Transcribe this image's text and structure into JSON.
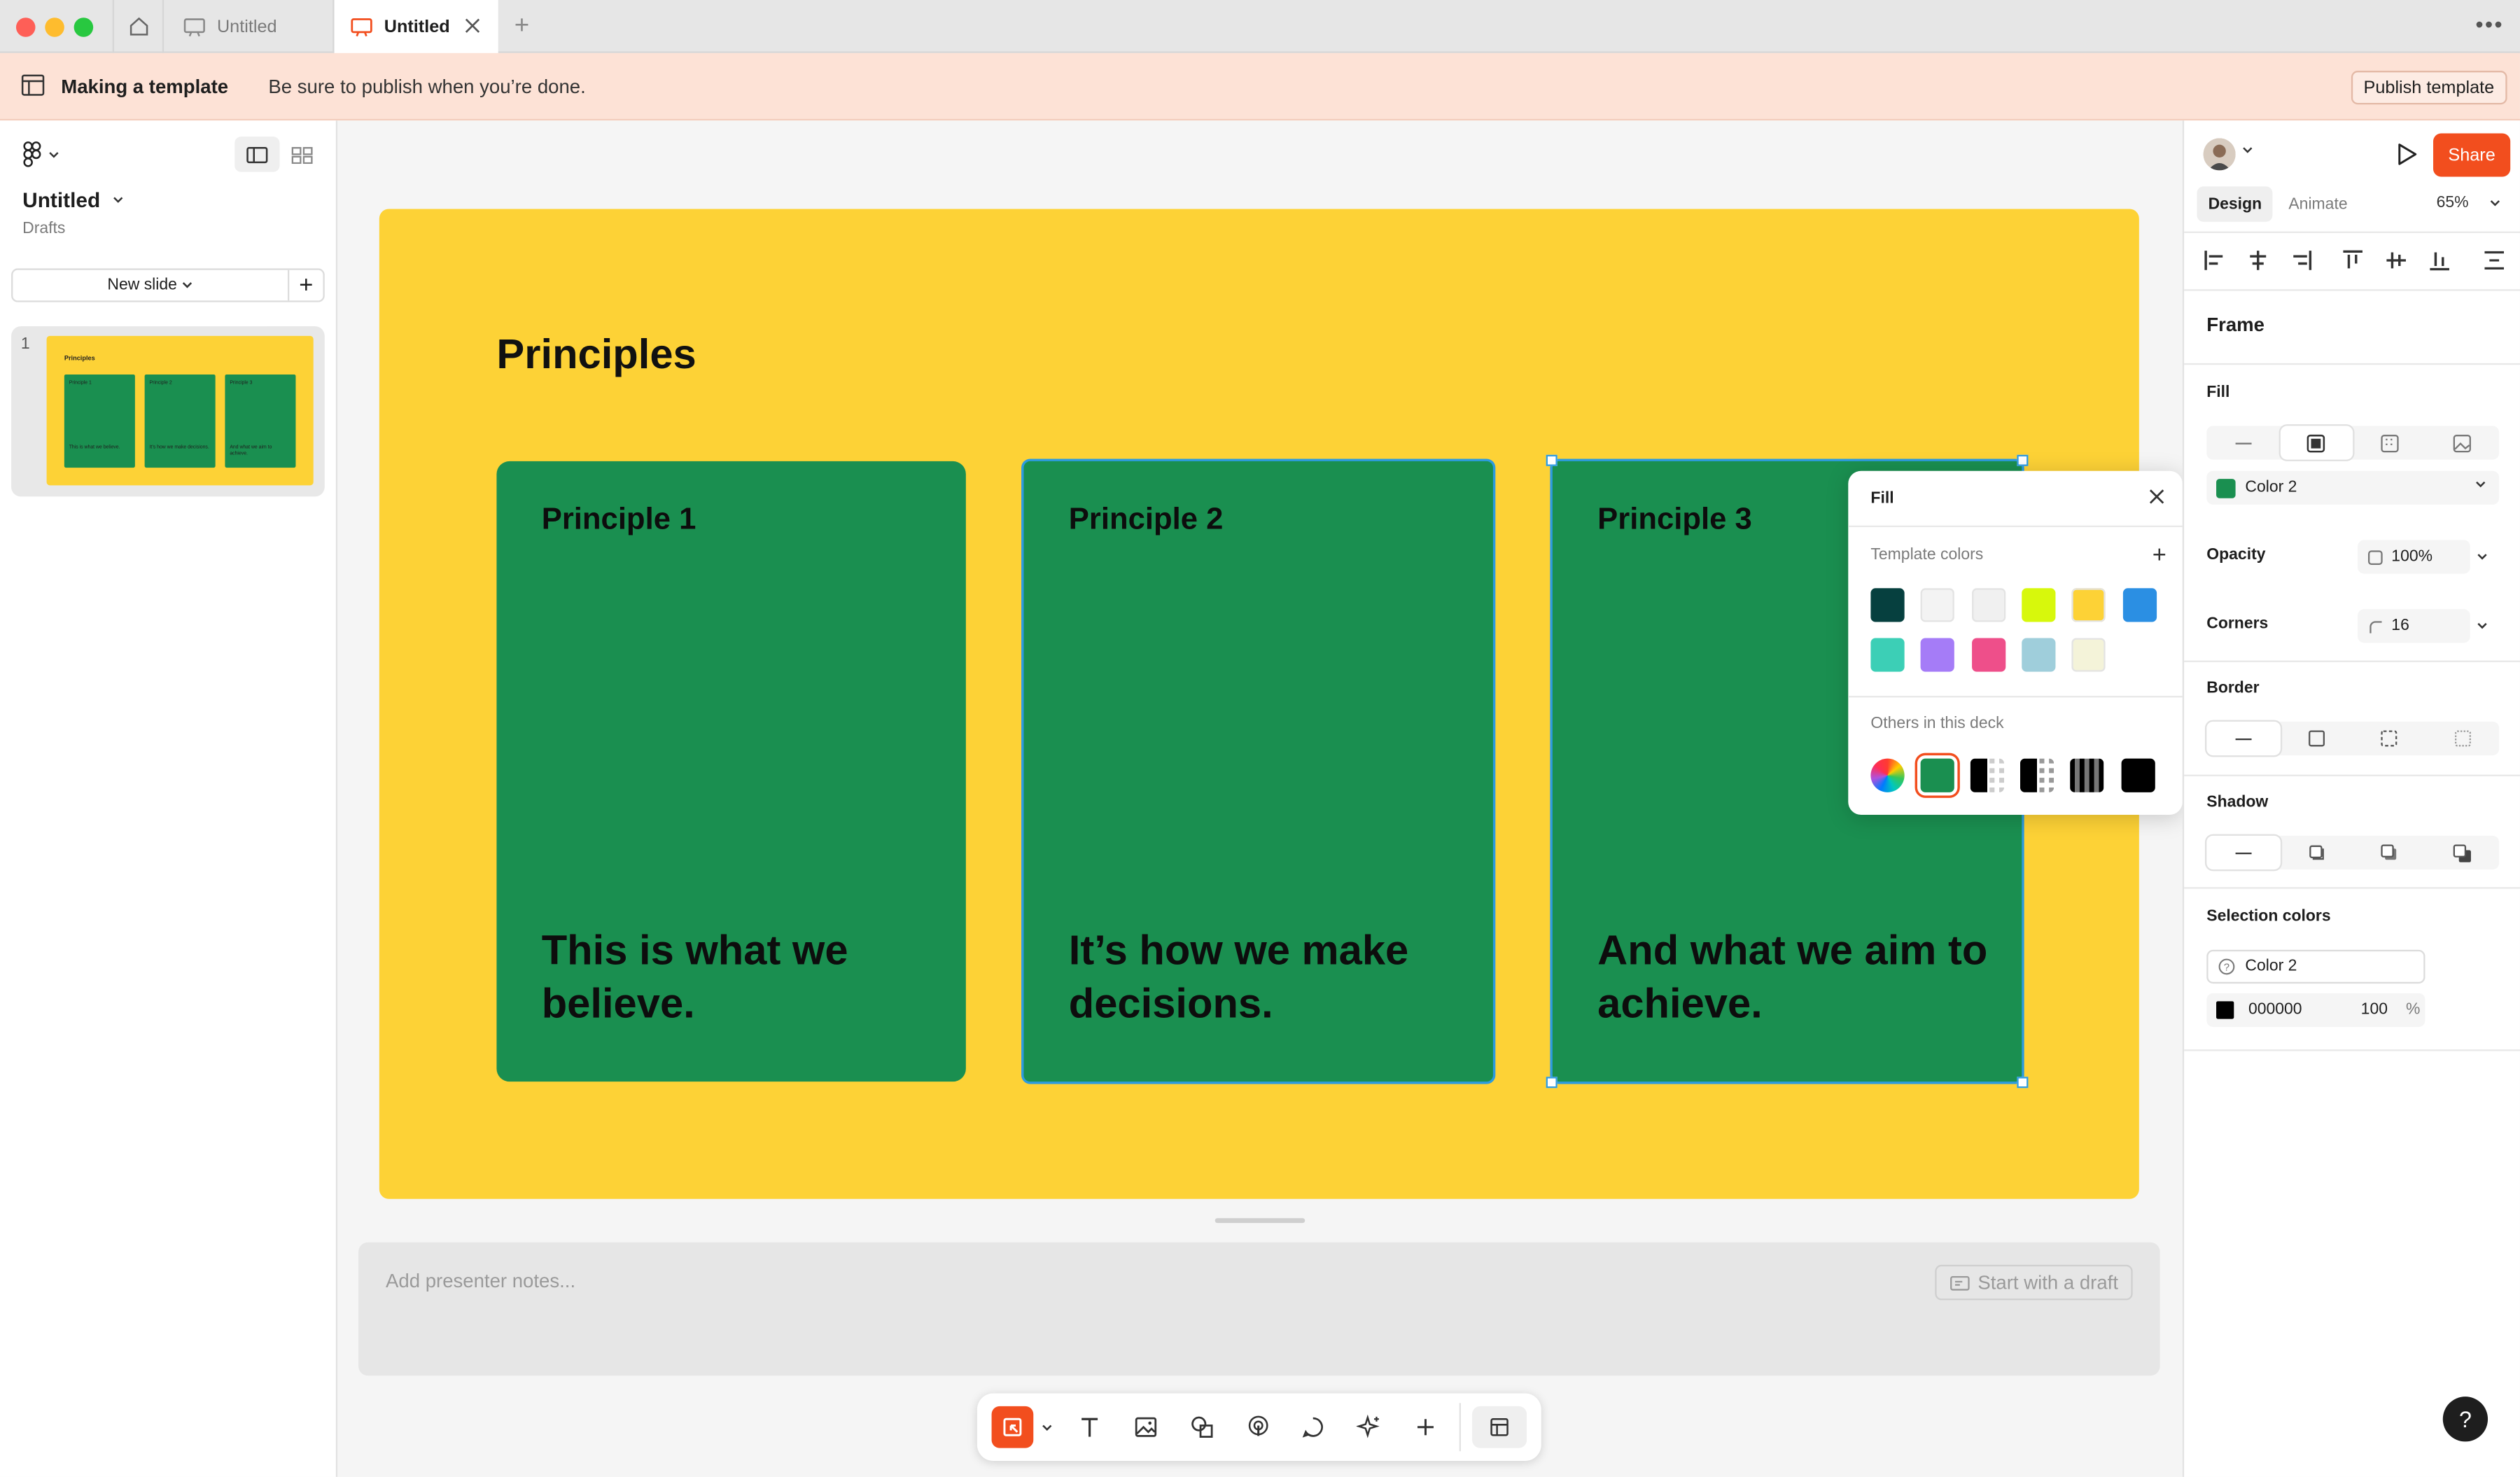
{
  "window": {
    "tabs": [
      {
        "label": "Untitled"
      },
      {
        "label": "Untitled"
      }
    ]
  },
  "banner": {
    "title": "Making a template",
    "message": "Be sure to publish when you’re done.",
    "publish_label": "Publish template"
  },
  "left": {
    "file_name": "Untitled",
    "location": "Drafts",
    "new_slide_label": "New slide",
    "slide_number": "1"
  },
  "slide": {
    "title": "Principles",
    "cards": [
      {
        "heading": "Principle 1",
        "body": "This is what we believe."
      },
      {
        "heading": "Principle 2",
        "body": "It’s how we make decisions."
      },
      {
        "heading": "Principle 3",
        "body": "And what we aim to achieve."
      }
    ]
  },
  "notes": {
    "placeholder": "Add presenter notes...",
    "draft_label": "Start with a draft"
  },
  "fill_popover": {
    "title": "Fill",
    "template_colors_label": "Template colors",
    "others_label": "Others in this deck",
    "template_colors": [
      "#06403f",
      "#f3f3f3",
      "#f0f0f0",
      "#d7f80c",
      "#fdd236",
      "#2b8fe3",
      "#3ccfb6",
      "#a57cf7",
      "#ee4f8a",
      "#9fcedb",
      "#f4f3d9"
    ]
  },
  "right": {
    "share_label": "Share",
    "design_tab": "Design",
    "animate_tab": "Animate",
    "zoom": "65%",
    "frame_label": "Frame",
    "fill_label": "Fill",
    "fill_value": "Color 2",
    "opacity_label": "Opacity",
    "opacity_value": "100%",
    "corners_label": "Corners",
    "corners_value": "16",
    "border_label": "Border",
    "shadow_label": "Shadow",
    "selection_colors_label": "Selection colors",
    "selection_color_name": "Color 2",
    "selection_hex": "000000",
    "selection_opacity": "100",
    "selection_pct": "%",
    "help_label": "?"
  },
  "colors": {
    "slide_bg": "#fdd236",
    "card_green": "#1a8f50",
    "accent": "#f24e1e",
    "selection": "#2d9be0"
  }
}
